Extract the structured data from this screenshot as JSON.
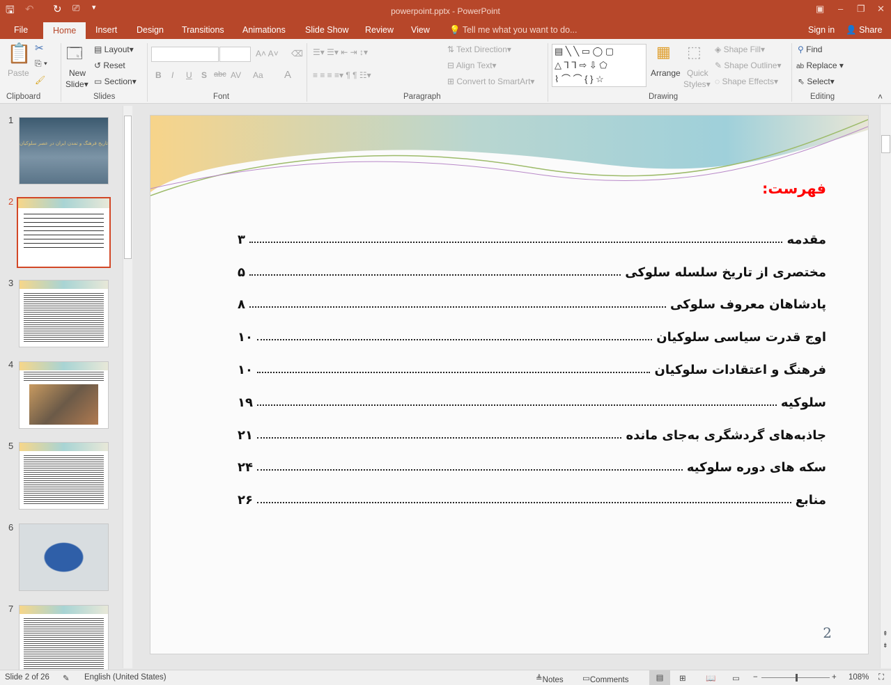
{
  "window": {
    "title": "powerpoint.pptx - PowerPoint",
    "sign_in": "Sign in",
    "share": "Share"
  },
  "tabs": [
    "File",
    "Home",
    "Insert",
    "Design",
    "Transitions",
    "Animations",
    "Slide Show",
    "Review",
    "View"
  ],
  "tell_me": "Tell me what you want to do...",
  "ribbon": {
    "clipboard": {
      "label": "Clipboard",
      "paste": "Paste"
    },
    "slides": {
      "label": "Slides",
      "new_slide": "New",
      "new_slide2": "Slide",
      "layout": "Layout",
      "reset": "Reset",
      "section": "Section"
    },
    "font": {
      "label": "Font",
      "bold": "B",
      "italic": "I",
      "underline": "U",
      "shadow": "S",
      "strike": "abc",
      "spacing": "AV",
      "case": "Aa",
      "color": "A"
    },
    "paragraph": {
      "label": "Paragraph",
      "text_direction": "Text Direction",
      "align_text": "Align Text",
      "smartart": "Convert to SmartArt"
    },
    "drawing": {
      "label": "Drawing",
      "arrange": "Arrange",
      "quick_styles": "Quick",
      "quick_styles2": "Styles",
      "shape_fill": "Shape Fill",
      "shape_outline": "Shape Outline",
      "shape_effects": "Shape Effects"
    },
    "editing": {
      "label": "Editing",
      "find": "Find",
      "replace": "Replace",
      "select": "Select"
    }
  },
  "thumbnails": [
    {
      "num": "1",
      "title": "تاریخ فرهنگ و تمدن ایران در عصر سلوکیان"
    },
    {
      "num": "2"
    },
    {
      "num": "3"
    },
    {
      "num": "4"
    },
    {
      "num": "5"
    },
    {
      "num": "6"
    },
    {
      "num": "7"
    }
  ],
  "slide": {
    "title": "فهرست:",
    "entries": [
      {
        "text": "مقدمه",
        "page": "۳"
      },
      {
        "text": "مختصری از تاریخ سلسله سلوکی",
        "page": "۵"
      },
      {
        "text": "پادشاهان معروف سلوکی",
        "page": "۸"
      },
      {
        "text": "اوج قدرت سیاسی سلوکیان",
        "page": "۱۰"
      },
      {
        "text": "فرهنگ و اعتقادات سلوکیان",
        "page": "۱۰"
      },
      {
        "text": "سلوکیه",
        "page": "۱۹"
      },
      {
        "text": "جاذبه‌های گردشگری به‌جای مانده",
        "page": "۲۱"
      },
      {
        "text": "سکه های دوره سلوکیه",
        "page": "۲۴"
      },
      {
        "text": "منابع",
        "page": "۲۶"
      }
    ],
    "slide_number": "2"
  },
  "status": {
    "slide": "Slide 2 of 26",
    "language": "English (United States)",
    "notes": "Notes",
    "comments": "Comments",
    "zoom": "108%"
  },
  "colors": {
    "accent": "#b7472a",
    "title_red": "#ff0000"
  }
}
